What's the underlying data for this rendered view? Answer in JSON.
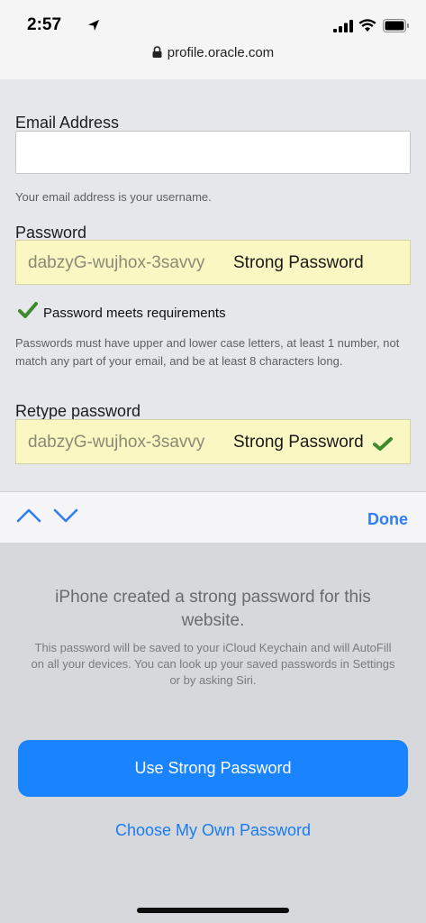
{
  "status_bar": {
    "time": "2:57",
    "url": "profile.oracle.com"
  },
  "form": {
    "email_label": "Email Address",
    "email_value": "",
    "email_help": "Your email address is your username.",
    "password_label": "Password",
    "password_value": "dabzyG-wujhox-3savvy",
    "password_strength": "Strong Password",
    "requirements_met": "Password meets requirements",
    "password_help": "Passwords must have upper and lower case letters, at least 1 number, not match any part of your email, and be at least 8 characters long.",
    "retype_label": "Retype password",
    "retype_value": "dabzyG-wujhox-3savvy",
    "retype_strength": "Strong Password"
  },
  "accessory": {
    "done_label": "Done"
  },
  "suggestion": {
    "title": "iPhone created a strong password for this website.",
    "description": "This password will be saved to your iCloud Keychain and will AutoFill on all your devices. You can look up your saved passwords in Settings or by asking Siri.",
    "use_button": "Use Strong Password",
    "own_button": "Choose My Own Password"
  },
  "colors": {
    "accent": "#1a84ff",
    "autofill_bg": "#fbf7c2",
    "check_green": "#3d8a2c"
  }
}
